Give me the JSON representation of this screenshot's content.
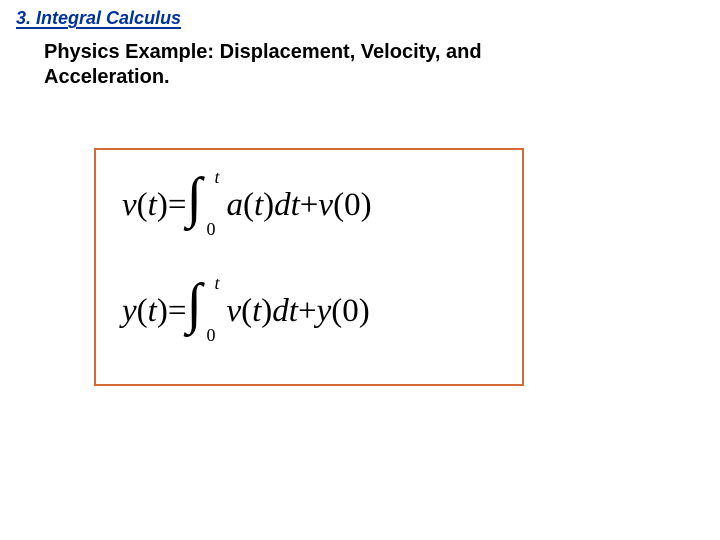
{
  "section": {
    "number": "3.",
    "title": "Integral Calculus"
  },
  "subtitle": "Physics Example: Displacement, Velocity, and Acceleration.",
  "equations": {
    "eq1": {
      "lhs_var": "v",
      "lhs_arg_open": "(",
      "lhs_arg": "t",
      "lhs_arg_close": ")",
      "equals": " = ",
      "int_lower": "0",
      "int_upper": "t",
      "integrand_var": "a",
      "integrand_open": "(",
      "integrand_arg": "t",
      "integrand_close": ")",
      "diff": "dt",
      "plus": " + ",
      "init_var": "v",
      "init_open": "(",
      "init_arg": "0",
      "init_close": ")"
    },
    "eq2": {
      "lhs_var": "y",
      "lhs_arg_open": "(",
      "lhs_arg": "t",
      "lhs_arg_close": ")",
      "equals": " = ",
      "int_lower": "0",
      "int_upper": "t",
      "integrand_var": "v",
      "integrand_open": "(",
      "integrand_arg": "t",
      "integrand_close": ")",
      "diff": "dt",
      "plus": " + ",
      "init_var": "y",
      "init_open": "(",
      "init_arg": "0",
      "init_close": ")"
    }
  }
}
